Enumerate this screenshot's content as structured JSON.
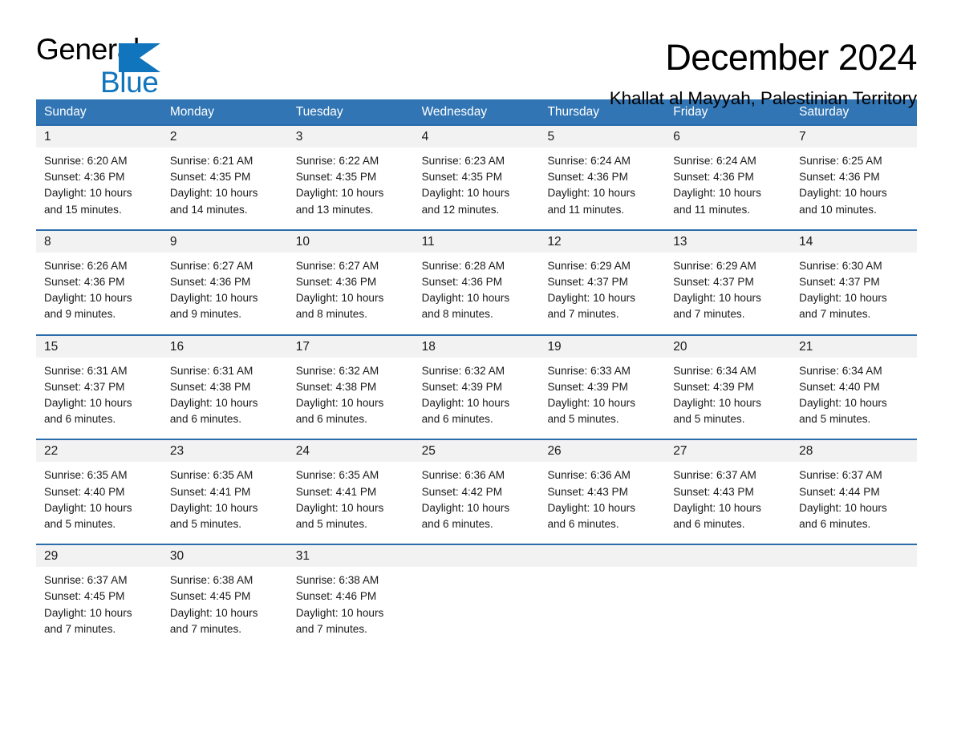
{
  "brand": {
    "name_part1": "General",
    "name_part2": "Blue",
    "logo_icon": "triangle-flag-icon",
    "accent_color": "#1175bd"
  },
  "header": {
    "month_title": "December 2024",
    "location": "Khallat al Mayyah, Palestinian Territory",
    "header_bg_color": "#3175b4",
    "daynum_bg_color": "#f2f2f2"
  },
  "calendar": {
    "weekdays": [
      "Sunday",
      "Monday",
      "Tuesday",
      "Wednesday",
      "Thursday",
      "Friday",
      "Saturday"
    ],
    "weeks": [
      [
        {
          "day": "1",
          "sunrise": "Sunrise: 6:20 AM",
          "sunset": "Sunset: 4:36 PM",
          "daylight_line1": "Daylight: 10 hours",
          "daylight_line2": "and 15 minutes."
        },
        {
          "day": "2",
          "sunrise": "Sunrise: 6:21 AM",
          "sunset": "Sunset: 4:35 PM",
          "daylight_line1": "Daylight: 10 hours",
          "daylight_line2": "and 14 minutes."
        },
        {
          "day": "3",
          "sunrise": "Sunrise: 6:22 AM",
          "sunset": "Sunset: 4:35 PM",
          "daylight_line1": "Daylight: 10 hours",
          "daylight_line2": "and 13 minutes."
        },
        {
          "day": "4",
          "sunrise": "Sunrise: 6:23 AM",
          "sunset": "Sunset: 4:35 PM",
          "daylight_line1": "Daylight: 10 hours",
          "daylight_line2": "and 12 minutes."
        },
        {
          "day": "5",
          "sunrise": "Sunrise: 6:24 AM",
          "sunset": "Sunset: 4:36 PM",
          "daylight_line1": "Daylight: 10 hours",
          "daylight_line2": "and 11 minutes."
        },
        {
          "day": "6",
          "sunrise": "Sunrise: 6:24 AM",
          "sunset": "Sunset: 4:36 PM",
          "daylight_line1": "Daylight: 10 hours",
          "daylight_line2": "and 11 minutes."
        },
        {
          "day": "7",
          "sunrise": "Sunrise: 6:25 AM",
          "sunset": "Sunset: 4:36 PM",
          "daylight_line1": "Daylight: 10 hours",
          "daylight_line2": "and 10 minutes."
        }
      ],
      [
        {
          "day": "8",
          "sunrise": "Sunrise: 6:26 AM",
          "sunset": "Sunset: 4:36 PM",
          "daylight_line1": "Daylight: 10 hours",
          "daylight_line2": "and 9 minutes."
        },
        {
          "day": "9",
          "sunrise": "Sunrise: 6:27 AM",
          "sunset": "Sunset: 4:36 PM",
          "daylight_line1": "Daylight: 10 hours",
          "daylight_line2": "and 9 minutes."
        },
        {
          "day": "10",
          "sunrise": "Sunrise: 6:27 AM",
          "sunset": "Sunset: 4:36 PM",
          "daylight_line1": "Daylight: 10 hours",
          "daylight_line2": "and 8 minutes."
        },
        {
          "day": "11",
          "sunrise": "Sunrise: 6:28 AM",
          "sunset": "Sunset: 4:36 PM",
          "daylight_line1": "Daylight: 10 hours",
          "daylight_line2": "and 8 minutes."
        },
        {
          "day": "12",
          "sunrise": "Sunrise: 6:29 AM",
          "sunset": "Sunset: 4:37 PM",
          "daylight_line1": "Daylight: 10 hours",
          "daylight_line2": "and 7 minutes."
        },
        {
          "day": "13",
          "sunrise": "Sunrise: 6:29 AM",
          "sunset": "Sunset: 4:37 PM",
          "daylight_line1": "Daylight: 10 hours",
          "daylight_line2": "and 7 minutes."
        },
        {
          "day": "14",
          "sunrise": "Sunrise: 6:30 AM",
          "sunset": "Sunset: 4:37 PM",
          "daylight_line1": "Daylight: 10 hours",
          "daylight_line2": "and 7 minutes."
        }
      ],
      [
        {
          "day": "15",
          "sunrise": "Sunrise: 6:31 AM",
          "sunset": "Sunset: 4:37 PM",
          "daylight_line1": "Daylight: 10 hours",
          "daylight_line2": "and 6 minutes."
        },
        {
          "day": "16",
          "sunrise": "Sunrise: 6:31 AM",
          "sunset": "Sunset: 4:38 PM",
          "daylight_line1": "Daylight: 10 hours",
          "daylight_line2": "and 6 minutes."
        },
        {
          "day": "17",
          "sunrise": "Sunrise: 6:32 AM",
          "sunset": "Sunset: 4:38 PM",
          "daylight_line1": "Daylight: 10 hours",
          "daylight_line2": "and 6 minutes."
        },
        {
          "day": "18",
          "sunrise": "Sunrise: 6:32 AM",
          "sunset": "Sunset: 4:39 PM",
          "daylight_line1": "Daylight: 10 hours",
          "daylight_line2": "and 6 minutes."
        },
        {
          "day": "19",
          "sunrise": "Sunrise: 6:33 AM",
          "sunset": "Sunset: 4:39 PM",
          "daylight_line1": "Daylight: 10 hours",
          "daylight_line2": "and 5 minutes."
        },
        {
          "day": "20",
          "sunrise": "Sunrise: 6:34 AM",
          "sunset": "Sunset: 4:39 PM",
          "daylight_line1": "Daylight: 10 hours",
          "daylight_line2": "and 5 minutes."
        },
        {
          "day": "21",
          "sunrise": "Sunrise: 6:34 AM",
          "sunset": "Sunset: 4:40 PM",
          "daylight_line1": "Daylight: 10 hours",
          "daylight_line2": "and 5 minutes."
        }
      ],
      [
        {
          "day": "22",
          "sunrise": "Sunrise: 6:35 AM",
          "sunset": "Sunset: 4:40 PM",
          "daylight_line1": "Daylight: 10 hours",
          "daylight_line2": "and 5 minutes."
        },
        {
          "day": "23",
          "sunrise": "Sunrise: 6:35 AM",
          "sunset": "Sunset: 4:41 PM",
          "daylight_line1": "Daylight: 10 hours",
          "daylight_line2": "and 5 minutes."
        },
        {
          "day": "24",
          "sunrise": "Sunrise: 6:35 AM",
          "sunset": "Sunset: 4:41 PM",
          "daylight_line1": "Daylight: 10 hours",
          "daylight_line2": "and 5 minutes."
        },
        {
          "day": "25",
          "sunrise": "Sunrise: 6:36 AM",
          "sunset": "Sunset: 4:42 PM",
          "daylight_line1": "Daylight: 10 hours",
          "daylight_line2": "and 6 minutes."
        },
        {
          "day": "26",
          "sunrise": "Sunrise: 6:36 AM",
          "sunset": "Sunset: 4:43 PM",
          "daylight_line1": "Daylight: 10 hours",
          "daylight_line2": "and 6 minutes."
        },
        {
          "day": "27",
          "sunrise": "Sunrise: 6:37 AM",
          "sunset": "Sunset: 4:43 PM",
          "daylight_line1": "Daylight: 10 hours",
          "daylight_line2": "and 6 minutes."
        },
        {
          "day": "28",
          "sunrise": "Sunrise: 6:37 AM",
          "sunset": "Sunset: 4:44 PM",
          "daylight_line1": "Daylight: 10 hours",
          "daylight_line2": "and 6 minutes."
        }
      ],
      [
        {
          "day": "29",
          "sunrise": "Sunrise: 6:37 AM",
          "sunset": "Sunset: 4:45 PM",
          "daylight_line1": "Daylight: 10 hours",
          "daylight_line2": "and 7 minutes."
        },
        {
          "day": "30",
          "sunrise": "Sunrise: 6:38 AM",
          "sunset": "Sunset: 4:45 PM",
          "daylight_line1": "Daylight: 10 hours",
          "daylight_line2": "and 7 minutes."
        },
        {
          "day": "31",
          "sunrise": "Sunrise: 6:38 AM",
          "sunset": "Sunset: 4:46 PM",
          "daylight_line1": "Daylight: 10 hours",
          "daylight_line2": "and 7 minutes."
        },
        {
          "day": "",
          "sunrise": "",
          "sunset": "",
          "daylight_line1": "",
          "daylight_line2": ""
        },
        {
          "day": "",
          "sunrise": "",
          "sunset": "",
          "daylight_line1": "",
          "daylight_line2": ""
        },
        {
          "day": "",
          "sunrise": "",
          "sunset": "",
          "daylight_line1": "",
          "daylight_line2": ""
        },
        {
          "day": "",
          "sunrise": "",
          "sunset": "",
          "daylight_line1": "",
          "daylight_line2": ""
        }
      ]
    ]
  }
}
